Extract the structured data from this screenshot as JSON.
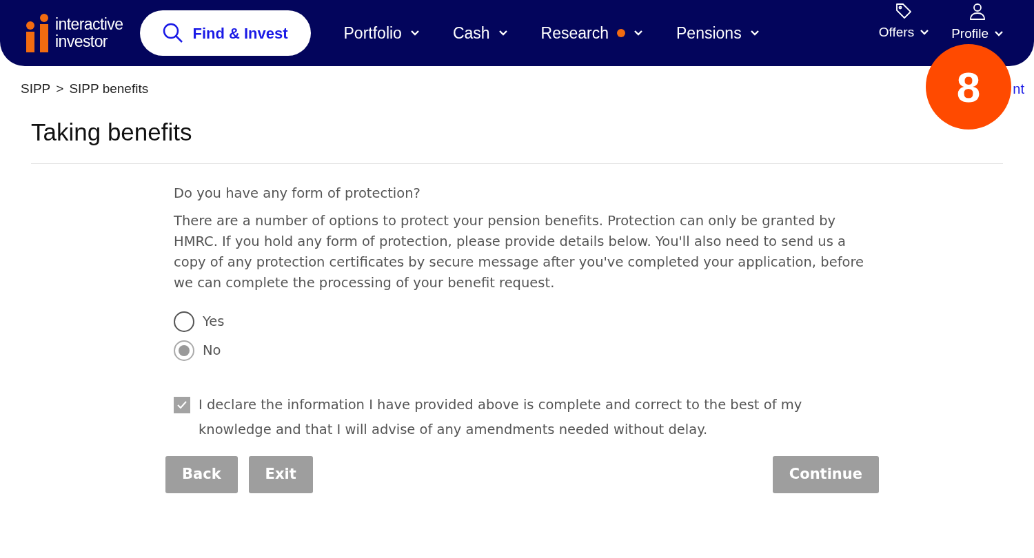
{
  "nav": {
    "logo": [
      "interactive",
      "investor"
    ],
    "search_button": "Find & Invest",
    "menu": [
      {
        "label": "Portfolio",
        "notification": false
      },
      {
        "label": "Cash",
        "notification": false
      },
      {
        "label": "Research",
        "notification": true
      },
      {
        "label": "Pensions",
        "notification": false
      }
    ],
    "utility": [
      {
        "label": "Offers",
        "kind": "tag"
      },
      {
        "label": "Profile",
        "kind": "person"
      }
    ]
  },
  "breadcrumb": [
    {
      "label": "SIPP"
    },
    {
      "label": ">"
    },
    {
      "label": "SIPP benefits"
    }
  ],
  "partial_link": "nt",
  "step_badge": "8",
  "title": "Taking benefits",
  "question": "Do you have any form of protection?",
  "explanation": "There are a number of options to protect your pension benefits. Protection can only be granted by HMRC. If you hold any form of protection, please provide details below. You'll also need to send us a copy of any protection certificates by secure message after you've completed your application, before we can complete the processing of your benefit request.",
  "options": [
    {
      "label": "Yes",
      "selected": false
    },
    {
      "label": "No",
      "selected": true
    }
  ],
  "declaration": {
    "label": "I declare the information I have provided above is complete and correct to the best of my knowledge and that I will advise of any amendments needed without delay.",
    "checked": true
  },
  "buttons_left": [
    "Back",
    "Exit"
  ],
  "buttons_right": [
    "Continue"
  ]
}
